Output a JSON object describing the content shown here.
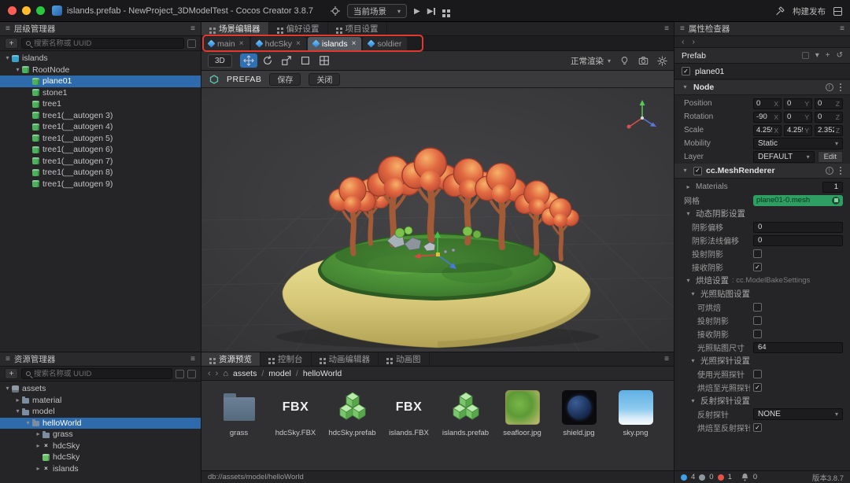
{
  "titlebar": {
    "title": "islands.prefab - NewProject_3DModelTest - Cocos Creator 3.8.7",
    "scene_select": "当前场景",
    "build_label": "构建发布"
  },
  "hierarchy": {
    "title": "层级管理器",
    "search_placeholder": "搜索名称或 UUID",
    "items": [
      {
        "label": "islands",
        "depth": 0,
        "icon": "scene",
        "caret": "▾"
      },
      {
        "label": "RootNode",
        "depth": 1,
        "icon": "node",
        "caret": "▾"
      },
      {
        "label": "plane01",
        "depth": 2,
        "icon": "node",
        "selected": true
      },
      {
        "label": "stone1",
        "depth": 2,
        "icon": "node"
      },
      {
        "label": "tree1",
        "depth": 2,
        "icon": "node"
      },
      {
        "label": "tree1(__autogen 3)",
        "depth": 2,
        "icon": "node"
      },
      {
        "label": "tree1(__autogen 4)",
        "depth": 2,
        "icon": "node"
      },
      {
        "label": "tree1(__autogen 5)",
        "depth": 2,
        "icon": "node"
      },
      {
        "label": "tree1(__autogen 6)",
        "depth": 2,
        "icon": "node"
      },
      {
        "label": "tree1(__autogen 7)",
        "depth": 2,
        "icon": "node"
      },
      {
        "label": "tree1(__autogen 8)",
        "depth": 2,
        "icon": "node"
      },
      {
        "label": "tree1(__autogen 9)",
        "depth": 2,
        "icon": "node"
      }
    ]
  },
  "assets_panel": {
    "title": "资源管理器",
    "search_placeholder": "搜索名称或 UUID",
    "items": [
      {
        "label": "assets",
        "depth": 0,
        "icon": "assets-root",
        "caret": "▾"
      },
      {
        "label": "material",
        "depth": 1,
        "icon": "folder",
        "caret": "▸"
      },
      {
        "label": "model",
        "depth": 1,
        "icon": "folder",
        "caret": "▾"
      },
      {
        "label": "helloWorld",
        "depth": 2,
        "icon": "folder",
        "caret": "▾",
        "selected": true
      },
      {
        "label": "grass",
        "depth": 3,
        "icon": "folder",
        "caret": "▸"
      },
      {
        "label": "hdcSky",
        "depth": 3,
        "icon": "fbx",
        "caret": "▸"
      },
      {
        "label": "hdcSky",
        "depth": 3,
        "icon": "prefab"
      },
      {
        "label": "islands",
        "depth": 3,
        "icon": "fbx",
        "caret": "▸"
      }
    ]
  },
  "editor_tabs": {
    "tabs": [
      {
        "label": "场景编辑器"
      },
      {
        "label": "偏好设置"
      },
      {
        "label": "项目设置"
      }
    ]
  },
  "scene_tabs": {
    "tabs": [
      {
        "label": "main",
        "closable": true
      },
      {
        "label": "hdcSky",
        "closable": true
      },
      {
        "label": "islands",
        "closable": true,
        "active": true
      },
      {
        "label": "soldier",
        "closable": false
      }
    ]
  },
  "scene_toolbar": {
    "dimension": "3D",
    "render_mode": "正常渲染"
  },
  "prefab_bar": {
    "label": "PREFAB",
    "save": "保存",
    "close": "关闭"
  },
  "bottom_tabs": {
    "tabs": [
      {
        "label": "资源预览"
      },
      {
        "label": "控制台"
      },
      {
        "label": "动画编辑器"
      },
      {
        "label": "动画图"
      }
    ]
  },
  "breadcrumb": {
    "segments": [
      "assets",
      "model",
      "helloWorld"
    ],
    "separator": "/"
  },
  "asset_grid": {
    "items": [
      {
        "name": "grass",
        "kind": "folder"
      },
      {
        "name": "hdcSky.FBX",
        "kind": "fbx",
        "icon_text": "FBX"
      },
      {
        "name": "hdcSky.prefab",
        "kind": "prefab"
      },
      {
        "name": "islands.FBX",
        "kind": "fbx",
        "icon_text": "FBX"
      },
      {
        "name": "islands.prefab",
        "kind": "prefab"
      },
      {
        "name": "seafloor.jpg",
        "kind": "img-seafloor"
      },
      {
        "name": "shield.jpg",
        "kind": "img-shield"
      },
      {
        "name": "sky.png",
        "kind": "img-sky"
      }
    ]
  },
  "asset_status": "db://assets/model/helloWorld",
  "inspector": {
    "title": "属性检查器",
    "prefab_label": "Prefab",
    "node_name": "plane01",
    "node_section": "Node",
    "axis": {
      "x": "X",
      "y": "Y",
      "z": "Z"
    },
    "position": {
      "label": "Position",
      "x": "0",
      "y": "0",
      "z": "0"
    },
    "rotation": {
      "label": "Rotation",
      "x": "-90",
      "y": "0",
      "z": "0"
    },
    "scale": {
      "label": "Scale",
      "x": "4.2596",
      "y": "4.2596",
      "z": "2.3524"
    },
    "mobility": {
      "label": "Mobility",
      "value": "Static"
    },
    "layer": {
      "label": "Layer",
      "value": "DEFAULT",
      "edit": "Edit"
    },
    "mesh_renderer": {
      "title": "cc.MeshRenderer",
      "materials_label": "Materials",
      "materials_value": "1",
      "mesh_label": "网格",
      "mesh_value": "plane01-0.mesh",
      "dyn_shadow_title": "动态阴影设置",
      "shadow_bias_label": "阴影偏移",
      "shadow_bias": "0",
      "shadow_normal_bias_label": "阴影法线偏移",
      "shadow_normal_bias": "0",
      "cast_label": "投射阴影",
      "receive_label": "接收阴影",
      "bake_title": "烘焙设置",
      "bake_class": ": cc.ModelBakeSettings",
      "lightmap_title": "光照贴图设置",
      "bakeable_label": "可烘焙",
      "lm_cast_label": "投射阴影",
      "lm_receive_label": "接收阴影",
      "lm_size_label": "光照贴图尺寸",
      "lm_size": "64",
      "probe_title": "光照探针设置",
      "use_probe_label": "使用光照探针",
      "bake_probe_label": "烘焙至光照探针",
      "refl_title": "反射探针设置",
      "refl_label": "反射探针",
      "refl_value": "NONE",
      "bake_refl_label": "烘焙至反射探针"
    }
  },
  "statusbar": {
    "count_blue": "4",
    "count_gray": "0",
    "count_red": "1",
    "bell_count": "0",
    "version": "版本3.8.7"
  }
}
